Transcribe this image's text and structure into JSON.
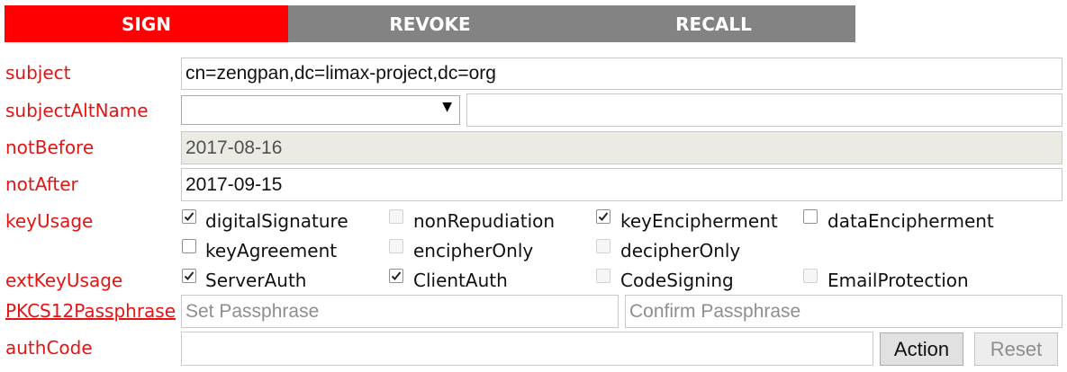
{
  "tabs": [
    {
      "label": "SIGN",
      "active": true
    },
    {
      "label": "REVOKE",
      "active": false
    },
    {
      "label": "RECALL",
      "active": false
    }
  ],
  "colors": {
    "active_tab": "#ff0000",
    "inactive_tab": "#838383",
    "label": "#e41414"
  },
  "form": {
    "subject": {
      "label": "subject",
      "value": "cn=zengpan,dc=limax-project,dc=org"
    },
    "subjectAltName": {
      "label": "subjectAltName",
      "select_value": "",
      "value": ""
    },
    "notBefore": {
      "label": "notBefore",
      "value": "2017-08-16",
      "disabled": true
    },
    "notAfter": {
      "label": "notAfter",
      "value": "2017-09-15"
    },
    "keyUsage": {
      "label": "keyUsage",
      "options": [
        {
          "label": "digitalSignature",
          "checked": true,
          "disabled": false
        },
        {
          "label": "nonRepudiation",
          "checked": false,
          "disabled": true
        },
        {
          "label": "keyEncipherment",
          "checked": true,
          "disabled": false
        },
        {
          "label": "dataEncipherment",
          "checked": false,
          "disabled": false
        },
        {
          "label": "keyAgreement",
          "checked": false,
          "disabled": false
        },
        {
          "label": "encipherOnly",
          "checked": false,
          "disabled": true
        },
        {
          "label": "decipherOnly",
          "checked": false,
          "disabled": true
        }
      ]
    },
    "extKeyUsage": {
      "label": "extKeyUsage",
      "options": [
        {
          "label": "ServerAuth",
          "checked": true,
          "disabled": false
        },
        {
          "label": "ClientAuth",
          "checked": true,
          "disabled": false
        },
        {
          "label": "CodeSigning",
          "checked": false,
          "disabled": true
        },
        {
          "label": "EmailProtection",
          "checked": false,
          "disabled": true
        }
      ]
    },
    "pkcs12": {
      "label": "PKCS12Passphrase",
      "placeholder": "Set Passphrase",
      "confirm_placeholder": "Confirm Passphrase"
    },
    "authCode": {
      "label": "authCode",
      "value": "",
      "action_label": "Action",
      "reset_label": "Reset"
    }
  }
}
